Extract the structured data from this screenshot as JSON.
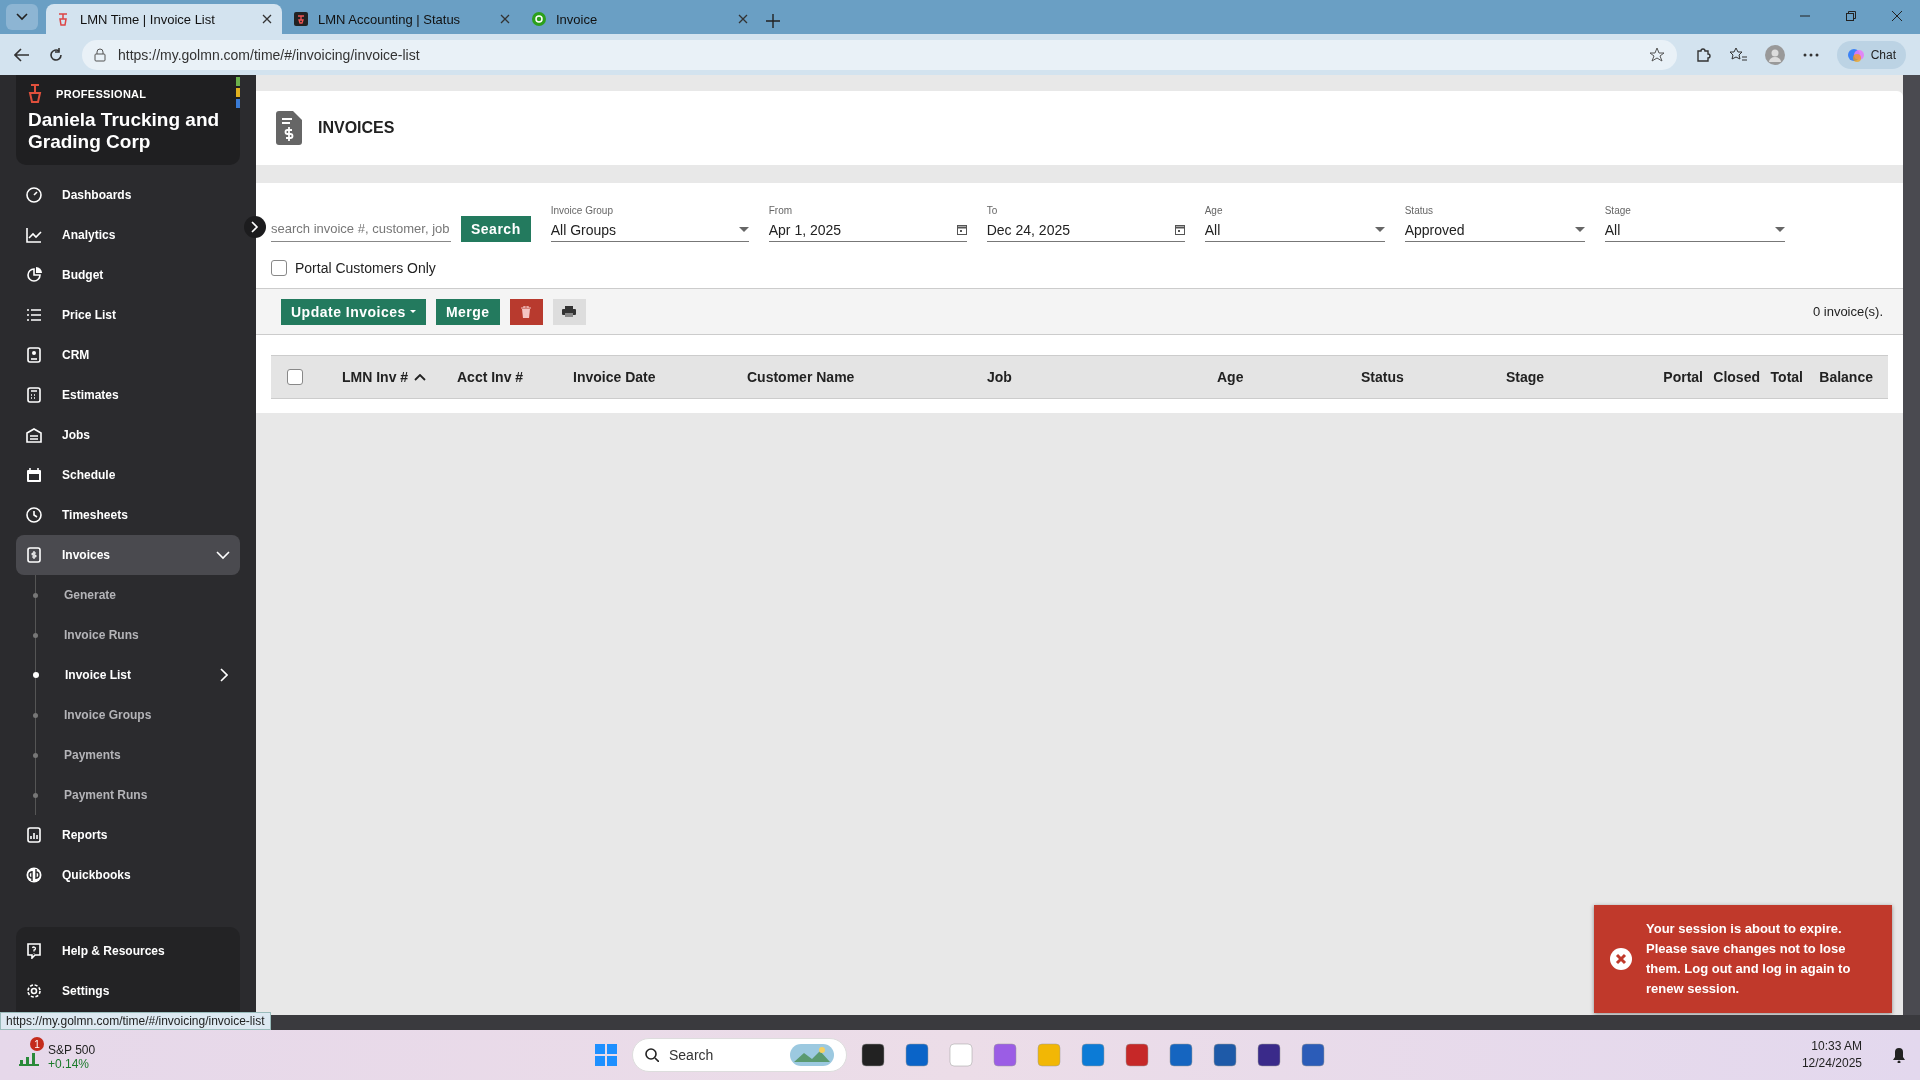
{
  "browser": {
    "tabs": [
      {
        "title": "LMN Time | Invoice List",
        "selected": true
      },
      {
        "title": "LMN Accounting | Status",
        "selected": false
      },
      {
        "title": "Invoice",
        "selected": false
      }
    ],
    "url": "https://my.golmn.com/time/#/invoicing/invoice-list",
    "chat_label": "Chat"
  },
  "sidebar": {
    "plan": "PROFESSIONAL",
    "company": "Daniela Trucking and Grading Corp",
    "items": [
      {
        "label": "Dashboards",
        "selected": false
      },
      {
        "label": "Analytics",
        "selected": false
      },
      {
        "label": "Budget",
        "selected": false
      },
      {
        "label": "Price List",
        "selected": false
      },
      {
        "label": "CRM",
        "selected": false
      },
      {
        "label": "Estimates",
        "selected": false
      },
      {
        "label": "Jobs",
        "selected": false
      },
      {
        "label": "Schedule",
        "selected": false
      },
      {
        "label": "Timesheets",
        "selected": false
      },
      {
        "label": "Invoices",
        "selected": true,
        "expanded": true,
        "children": [
          {
            "label": "Generate",
            "selected": false
          },
          {
            "label": "Invoice Runs",
            "selected": false
          },
          {
            "label": "Invoice List",
            "selected": true
          },
          {
            "label": "Invoice Groups",
            "selected": false
          },
          {
            "label": "Payments",
            "selected": false
          },
          {
            "label": "Payment Runs",
            "selected": false
          }
        ]
      },
      {
        "label": "Reports",
        "selected": false
      },
      {
        "label": "Quickbooks",
        "selected": false
      }
    ],
    "bottom_items": [
      {
        "label": "Help & Resources"
      },
      {
        "label": "Settings"
      }
    ]
  },
  "header": {
    "title": "INVOICES"
  },
  "filters": {
    "search": {
      "placeholder": "search invoice #, customer, job"
    },
    "search_button": "Search",
    "fields": [
      {
        "kind": "select",
        "label": "Invoice Group",
        "value": "All Groups"
      },
      {
        "kind": "date",
        "label": "From",
        "value": "Apr 1, 2025"
      },
      {
        "kind": "date",
        "label": "To",
        "value": "Dec 24, 2025"
      },
      {
        "kind": "select",
        "label": "Age",
        "value": "All"
      },
      {
        "kind": "select",
        "label": "Status",
        "value": "Approved"
      },
      {
        "kind": "select",
        "label": "Stage",
        "value": "All"
      }
    ],
    "portal_only": {
      "label": "Portal Customers Only",
      "checked": false
    }
  },
  "toolbar": {
    "update_button": "Update Invoices",
    "merge_button": "Merge",
    "count": "0 invoice(s)."
  },
  "table": {
    "select_all": false,
    "columns": [
      {
        "label": "LMN Inv #",
        "sorted": true
      },
      {
        "label": "Acct Inv #",
        "sorted": false
      },
      {
        "label": "Invoice Date",
        "sorted": false
      },
      {
        "label": "Customer Name",
        "sorted": false
      },
      {
        "label": "Job",
        "sorted": false
      },
      {
        "label": "Age",
        "sorted": false
      },
      {
        "label": "Status",
        "sorted": false
      },
      {
        "label": "Stage",
        "sorted": false
      },
      {
        "label": "Portal",
        "sorted": false
      },
      {
        "label": "Closed",
        "sorted": false
      },
      {
        "label": "Total",
        "sorted": false
      },
      {
        "label": "Balance",
        "sorted": false
      }
    ]
  },
  "toast": {
    "message": "Your session is about to expire. Please save changes not to lose them. Log out and log in again to renew session."
  },
  "status_url": "https://my.golmn.com/time/#/invoicing/invoice-list",
  "taskbar": {
    "ticker": {
      "badge": "1",
      "name": "S&P 500",
      "change": "+0.14%"
    },
    "search_placeholder": "Search",
    "time": "10:33 AM",
    "date": "12/24/2025"
  }
}
